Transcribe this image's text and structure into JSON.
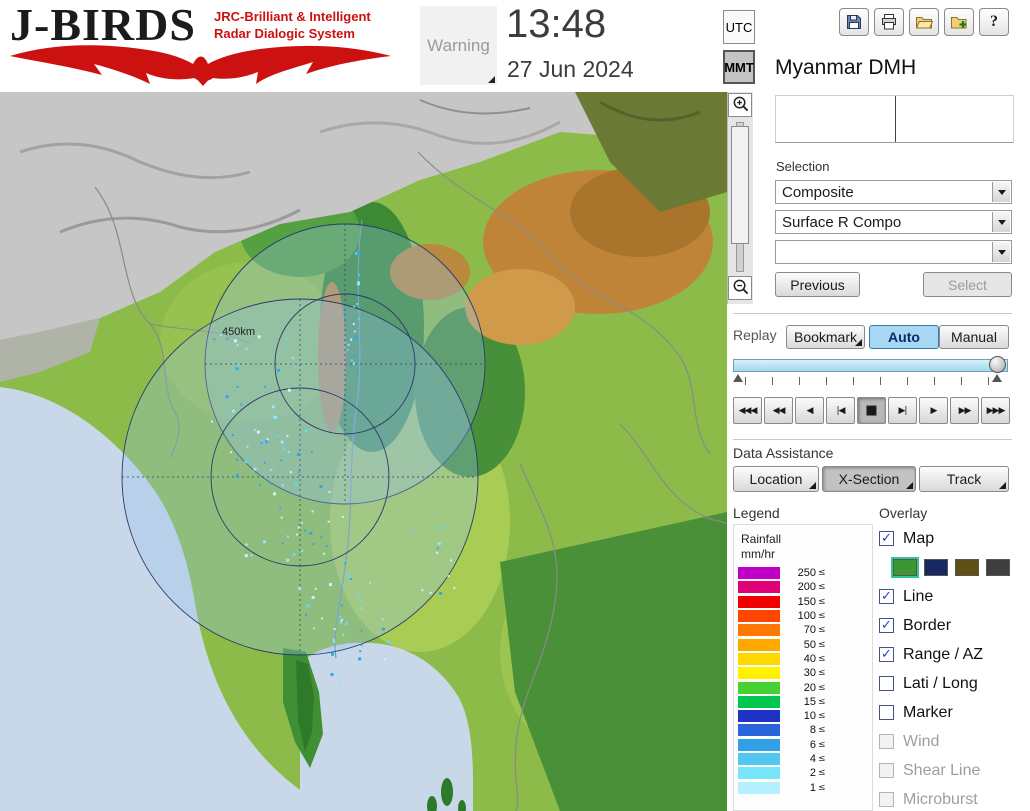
{
  "header": {
    "logo": {
      "title": "J-BIRDS",
      "subtitle_line1": "JRC-Brilliant & Intelligent",
      "subtitle_line2": "Radar  Dialogic  System"
    },
    "warning_label": "Warning",
    "clock": {
      "time": "13:48",
      "date": "27 Jun 2024"
    },
    "timezone": {
      "utc": "UTC",
      "mmt": "MMT",
      "selected": "MMT"
    },
    "toolbar_icons": [
      "save-icon",
      "print-icon",
      "open-folder-icon",
      "import-icon",
      "help-icon"
    ],
    "org_name": "Myanmar DMH"
  },
  "map": {
    "range_label": "450km",
    "echo_colors": [
      "#63d8f8",
      "#96e8ff",
      "#2fa8e8",
      "#c8f4ff"
    ]
  },
  "selection": {
    "label": "Selection",
    "dropdown1": "Composite",
    "dropdown2": "Surface R Compo",
    "dropdown3": "",
    "previous_button": "Previous",
    "select_button": "Select"
  },
  "replay": {
    "label": "Replay",
    "bookmark": "Bookmark",
    "auto": "Auto",
    "manual": "Manual",
    "mode_selected": "Auto",
    "playback": [
      "◀◀◀",
      "◀◀",
      "◀",
      "|◀",
      "■",
      "▶|",
      "▶",
      "▶▶",
      "▶▶▶"
    ],
    "pressed_index": 4
  },
  "data_assistance": {
    "label": "Data Assistance",
    "buttons": [
      "Location",
      "X-Section",
      "Track"
    ],
    "pressed": "X-Section"
  },
  "legend": {
    "title": "Legend",
    "unit_line1": "Rainfall",
    "unit_line2": "mm/hr",
    "suffix": "≤",
    "rows": [
      {
        "value": "250",
        "color": "#c000c8"
      },
      {
        "value": "200",
        "color": "#e00078"
      },
      {
        "value": "150",
        "color": "#f00000"
      },
      {
        "value": "100",
        "color": "#ff4600"
      },
      {
        "value": "70",
        "color": "#ff7800"
      },
      {
        "value": "50",
        "color": "#ffa800"
      },
      {
        "value": "40",
        "color": "#ffd800"
      },
      {
        "value": "30",
        "color": "#fff200"
      },
      {
        "value": "20",
        "color": "#46d232"
      },
      {
        "value": "15",
        "color": "#00c850"
      },
      {
        "value": "10",
        "color": "#1e32c8"
      },
      {
        "value": "8",
        "color": "#2864dc"
      },
      {
        "value": "6",
        "color": "#32a0e6"
      },
      {
        "value": "4",
        "color": "#50c8f0"
      },
      {
        "value": "2",
        "color": "#78e6fa"
      },
      {
        "value": "1",
        "color": "#b4f0ff"
      }
    ]
  },
  "overlay": {
    "title": "Overlay",
    "items": [
      {
        "label": "Map",
        "checked": true,
        "enabled": true
      },
      {
        "label": "Line",
        "checked": true,
        "enabled": true
      },
      {
        "label": "Border",
        "checked": true,
        "enabled": true
      },
      {
        "label": "Range / AZ",
        "checked": true,
        "enabled": true
      },
      {
        "label": "Lati / Long",
        "checked": false,
        "enabled": true
      },
      {
        "label": "Marker",
        "checked": false,
        "enabled": true
      },
      {
        "label": "Wind",
        "checked": false,
        "enabled": false
      },
      {
        "label": "Shear Line",
        "checked": false,
        "enabled": false
      },
      {
        "label": "Microburst",
        "checked": false,
        "enabled": false
      }
    ],
    "map_swatches": [
      "#3c9632",
      "#16285f",
      "#5f5014",
      "#3f3f3f"
    ],
    "selected_swatch_index": 0
  }
}
